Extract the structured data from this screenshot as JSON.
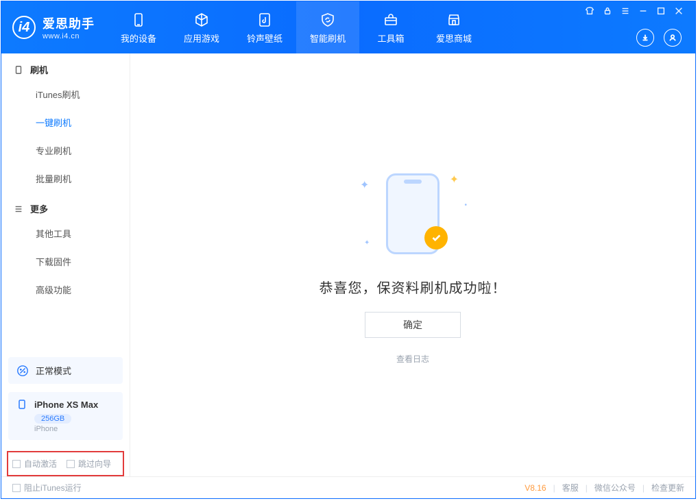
{
  "app": {
    "name_cn": "爱思助手",
    "name_en": "www.i4.cn"
  },
  "nav": {
    "items": [
      {
        "label": "我的设备"
      },
      {
        "label": "应用游戏"
      },
      {
        "label": "铃声壁纸"
      },
      {
        "label": "智能刷机"
      },
      {
        "label": "工具箱"
      },
      {
        "label": "爱思商城"
      }
    ]
  },
  "sidebar": {
    "group1": {
      "title": "刷机",
      "items": [
        "iTunes刷机",
        "一键刷机",
        "专业刷机",
        "批量刷机"
      ]
    },
    "group2": {
      "title": "更多",
      "items": [
        "其他工具",
        "下载固件",
        "高级功能"
      ]
    },
    "mode_card": "正常模式",
    "device": {
      "name": "iPhone XS Max",
      "capacity": "256GB",
      "type": "iPhone"
    },
    "options": {
      "auto_activate": "自动激活",
      "skip_guide": "跳过向导"
    }
  },
  "main": {
    "success": "恭喜您，保资料刷机成功啦！",
    "ok": "确定",
    "view_log": "查看日志"
  },
  "footer": {
    "block_itunes": "阻止iTunes运行",
    "version": "V8.16",
    "customer_service": "客服",
    "wechat": "微信公众号",
    "check_update": "检查更新"
  }
}
